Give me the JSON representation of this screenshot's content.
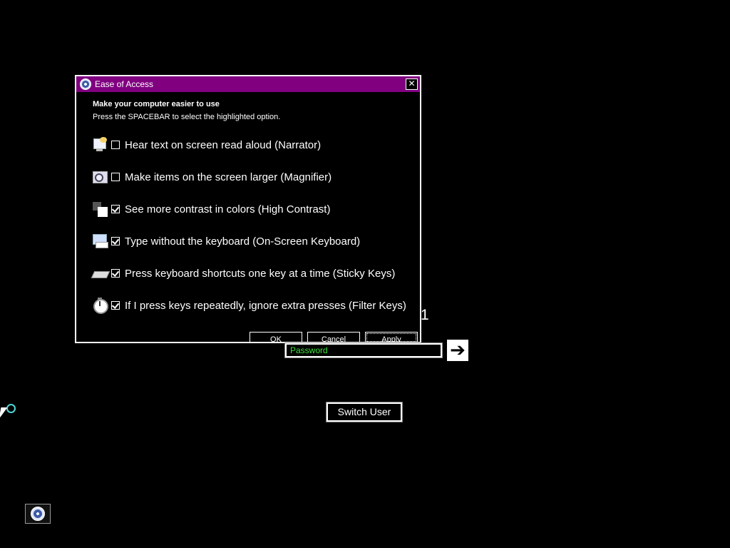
{
  "dialog": {
    "title": "Ease of Access",
    "close_glyph": "✕",
    "heading": "Make your computer easier to use",
    "instruction": "Press the SPACEBAR to select the highlighted option.",
    "options": [
      {
        "label": "Hear text on screen read aloud (Narrator)",
        "checked": false,
        "icon": "narrator-icon"
      },
      {
        "label": "Make items on the screen larger (Magnifier)",
        "checked": false,
        "icon": "magnifier-icon"
      },
      {
        "label": "See more contrast in colors (High Contrast)",
        "checked": true,
        "icon": "high-contrast-icon"
      },
      {
        "label": "Type without the keyboard (On-Screen Keyboard)",
        "checked": true,
        "icon": "on-screen-keyboard-icon"
      },
      {
        "label": "Press keyboard shortcuts one key at a time (Sticky Keys)",
        "checked": true,
        "icon": "sticky-keys-icon"
      },
      {
        "label": "If I press keys repeatedly, ignore extra presses (Filter Keys)",
        "checked": true,
        "icon": "filter-keys-icon"
      }
    ],
    "buttons": {
      "ok": "OK",
      "cancel": "Cancel",
      "apply": "Apply"
    }
  },
  "logon": {
    "user_number": "1",
    "password_placeholder": "Password",
    "go_arrow": "➔",
    "switch_user": "Switch User"
  },
  "colors": {
    "titlebar": "#800080",
    "password_text": "#3de03d",
    "busy_ring": "#4fd6d6"
  }
}
